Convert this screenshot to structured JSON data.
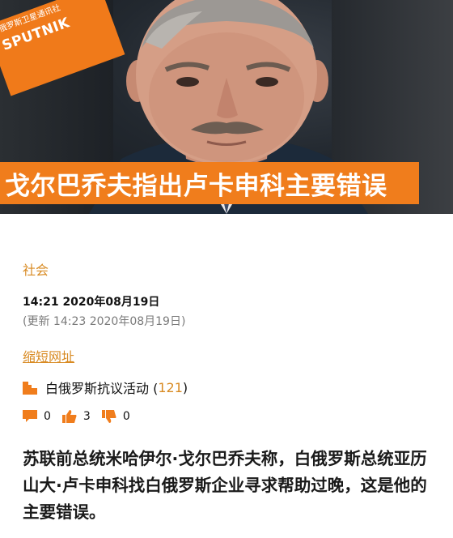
{
  "logo": {
    "top_text": "俄罗斯卫星通讯社",
    "brand": "SPUTNIK"
  },
  "headline": "戈尔巴乔夫指出卢卡申科主要错误",
  "colors": {
    "accent": "#f07d1c",
    "link": "#d88a22"
  },
  "article": {
    "category": "社会",
    "published": "14:21 2020年08月19日",
    "updated": "(更新 14:23 2020年08月19日)",
    "short_link": "缩短网址",
    "tag": {
      "label": "白俄罗斯抗议活动 (",
      "count": "121",
      "close": ")",
      "icon": "tag-icon"
    },
    "stats": {
      "comments": "0",
      "likes": "3",
      "dislikes": "0"
    },
    "lead": "苏联前总统米哈伊尔·戈尔巴乔夫称，白俄罗斯总统亚历山大·卢卡申科找白俄罗斯企业寻求帮助过晚，这是他的主要错误。"
  }
}
